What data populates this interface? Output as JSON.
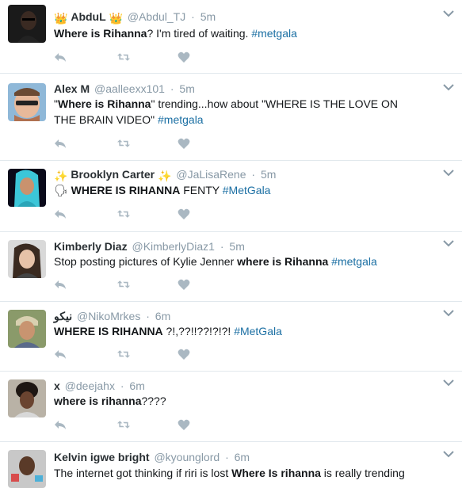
{
  "colors": {
    "hashtag": "#1b6fa3",
    "meta": "#8899a6",
    "divider": "#e1e8ed",
    "icon": "#aab8c2"
  },
  "icons": {
    "reply": "reply-icon",
    "retweet": "retweet-icon",
    "like": "heart-icon",
    "menu": "chevron-down-icon"
  },
  "tweets": [
    {
      "name_prefix": "👑",
      "name": "AbduL",
      "name_suffix": "👑",
      "handle": "@Abdul_TJ",
      "time": "5m",
      "segments": [
        {
          "text": "Where is Rihanna",
          "style": "bold"
        },
        {
          "text": "?  I'm tired of waiting. ",
          "style": "plain"
        },
        {
          "text": "#metgala",
          "style": "hashtag"
        }
      ]
    },
    {
      "name_prefix": "",
      "name": "Alex M",
      "name_suffix": "",
      "handle": "@aalleexx101",
      "time": "5m",
      "segments": [
        {
          "text": "\"",
          "style": "plain"
        },
        {
          "text": "Where is Rihanna",
          "style": "bold"
        },
        {
          "text": "\" trending...how about \"WHERE IS THE LOVE ON THE BRAIN VIDEO\" ",
          "style": "plain"
        },
        {
          "text": "#metgala",
          "style": "hashtag"
        }
      ]
    },
    {
      "name_prefix": "✨",
      "name": "Brooklyn Carter",
      "name_suffix": "✨",
      "handle": "@JaLisaRene",
      "time": "5m",
      "segments": [
        {
          "text": "🗣 ",
          "style": "plain"
        },
        {
          "text": "WHERE IS RIHANNA",
          "style": "bold"
        },
        {
          "text": " FENTY ",
          "style": "plain"
        },
        {
          "text": "#MetGala",
          "style": "hashtag"
        }
      ]
    },
    {
      "name_prefix": "",
      "name": "Kimberly Diaz",
      "name_suffix": "",
      "handle": "@KimberlyDiaz1",
      "time": "5m",
      "segments": [
        {
          "text": "Stop posting pictures of Kylie Jenner ",
          "style": "plain"
        },
        {
          "text": "where is Rihanna",
          "style": "bold"
        },
        {
          "text": " ",
          "style": "plain"
        },
        {
          "text": "#metgala",
          "style": "hashtag"
        }
      ]
    },
    {
      "name_prefix": "",
      "name": "نيكو",
      "name_suffix": "",
      "handle": "@NikoMrkes",
      "time": "6m",
      "segments": [
        {
          "text": "WHERE IS RIHANNA",
          "style": "bold"
        },
        {
          "text": " ?!,??!!??!?!?! ",
          "style": "plain"
        },
        {
          "text": "#MetGala",
          "style": "hashtag"
        }
      ]
    },
    {
      "name_prefix": "",
      "name": "x",
      "name_suffix": "",
      "handle": "@deejahx",
      "time": "6m",
      "segments": [
        {
          "text": "where is rihanna",
          "style": "bold"
        },
        {
          "text": "????",
          "style": "plain"
        }
      ]
    },
    {
      "name_prefix": "",
      "name": "Kelvin igwe bright",
      "name_suffix": "",
      "handle": "@kyounglord",
      "time": "6m",
      "segments": [
        {
          "text": "The internet got thinking if riri is lost ",
          "style": "plain"
        },
        {
          "text": "Where Is rihanna",
          "style": "bold"
        },
        {
          "text": " is really trending",
          "style": "plain"
        }
      ]
    }
  ]
}
